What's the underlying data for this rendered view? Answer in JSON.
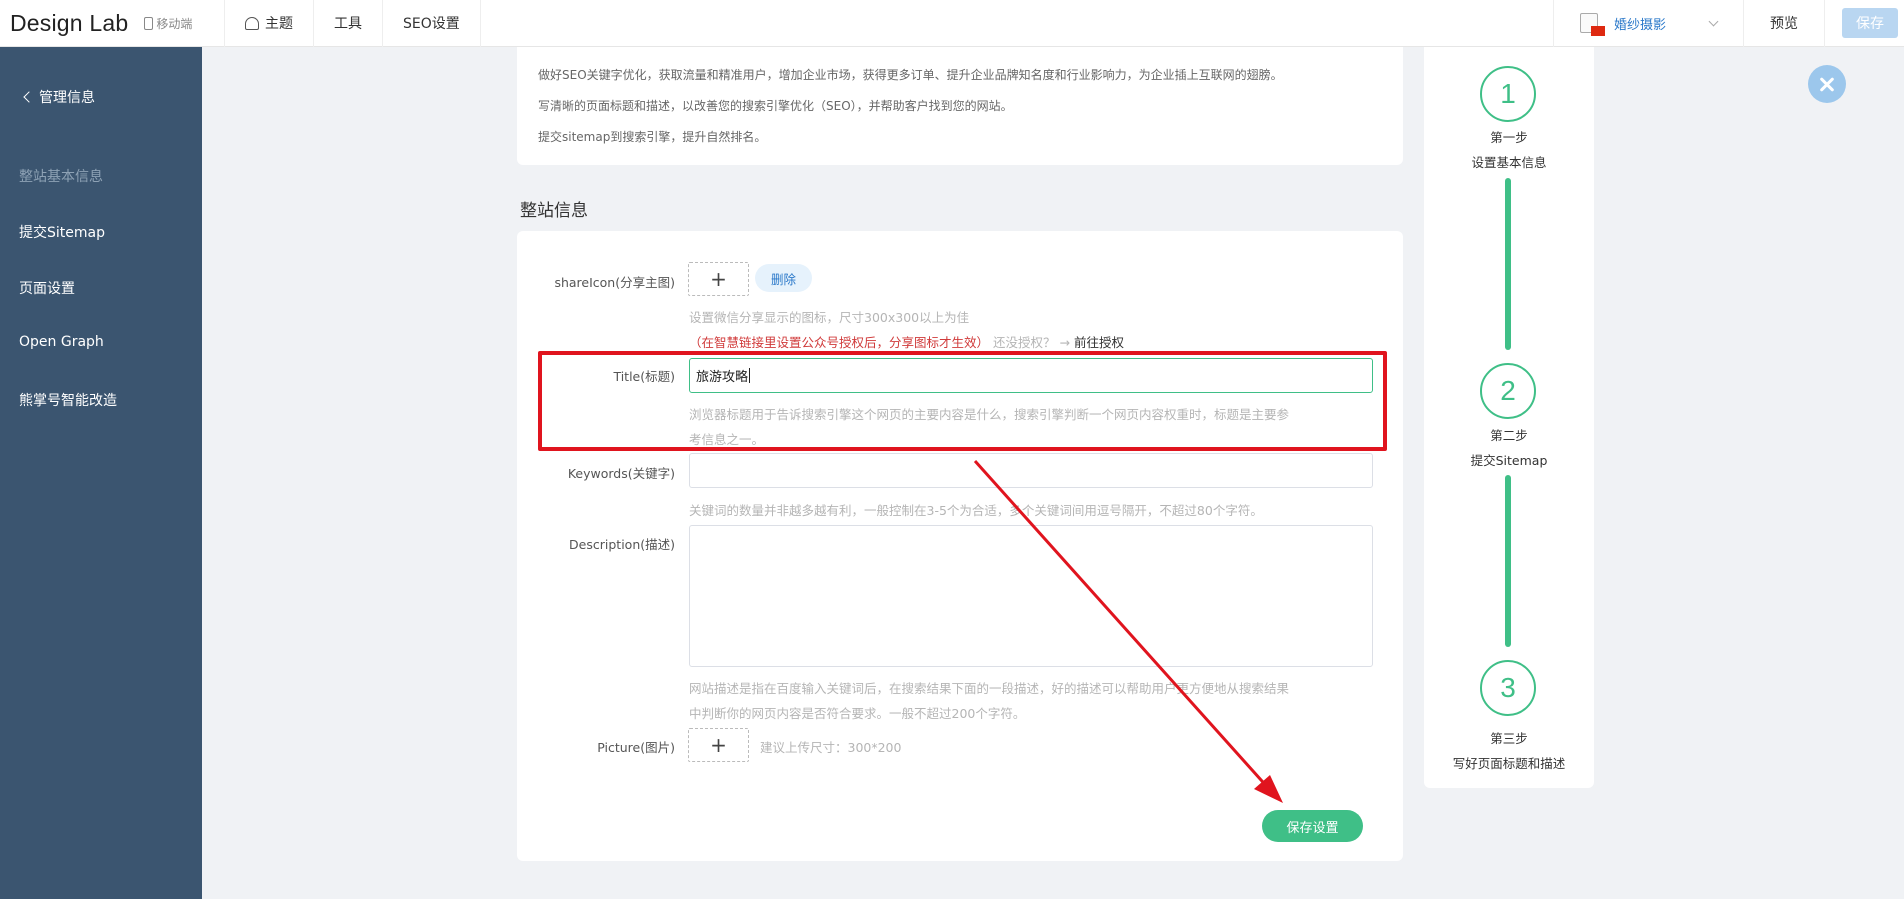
{
  "topbar": {
    "brand": "Design Lab",
    "mobile": "移动端",
    "nav": [
      "主题",
      "工具",
      "SEO设置"
    ],
    "site_name": "婚纱摄影",
    "preview": "预览",
    "save": "保存"
  },
  "sidebar": {
    "back": "管理信息",
    "items": [
      "整站基本信息",
      "提交Sitemap",
      "页面设置",
      "Open Graph",
      "熊掌号智能改造"
    ]
  },
  "intro": {
    "lines": [
      "做好SEO关键字优化，获取流量和精准用户，增加企业市场，获得更多订单、提升企业品牌知名度和行业影响力，为企业插上互联网的翅膀。",
      "写清晰的页面标题和描述，以改善您的搜索引擎优化（SEO），并帮助客户找到您的网站。",
      "提交sitemap到搜索引擎，提升自然排名。"
    ]
  },
  "section_title": "整站信息",
  "form": {
    "share_icon_label": "shareIcon(分享主图)",
    "delete": "删除",
    "share_hint1": "设置微信分享显示的图标，尺寸300x300以上为佳",
    "share_hint_red": "（在智慧链接里设置公众号授权后，分享图标才生效）",
    "share_hint_q": "还没授权？",
    "share_hint_arrow": "→",
    "share_hint_link": "前往授权",
    "title_label": "Title(标题)",
    "title_value": "旅游攻略",
    "title_hint1": "浏览器标题用于告诉搜索引擎这个网页的主要内容是什么，搜索引擎判断一个网页内容权重时，标题是主要参",
    "title_hint2": "考信息之一。",
    "keywords_label": "Keywords(关键字)",
    "keywords_value": "",
    "keywords_hint": "关键词的数量并非越多越有利，一般控制在3-5个为合适，多个关键词间用逗号隔开，不超过80个字符。",
    "description_label": "Description(描述)",
    "description_value": "",
    "description_hint1": "网站描述是指在百度输入关键词后，在搜索结果下面的一段描述，好的描述可以帮助用户更方便地从搜索结果",
    "description_hint2": "中判断你的网页内容是否符合要求。一般不超过200个字符。",
    "picture_label": "Picture(图片)",
    "picture_hint": "建议上传尺寸：300*200",
    "plus": "+",
    "save_settings": "保存设置"
  },
  "steps": [
    {
      "num": "1",
      "title": "第一步",
      "desc": "设置基本信息"
    },
    {
      "num": "2",
      "title": "第二步",
      "desc": "提交Sitemap"
    },
    {
      "num": "3",
      "title": "第三步",
      "desc": "写好页面标题和描述"
    }
  ],
  "colors": {
    "sidebar": "#3b5570",
    "accent_green": "#3fbf87",
    "annotation_red": "#e0141e",
    "link_blue": "#2a78c9"
  }
}
